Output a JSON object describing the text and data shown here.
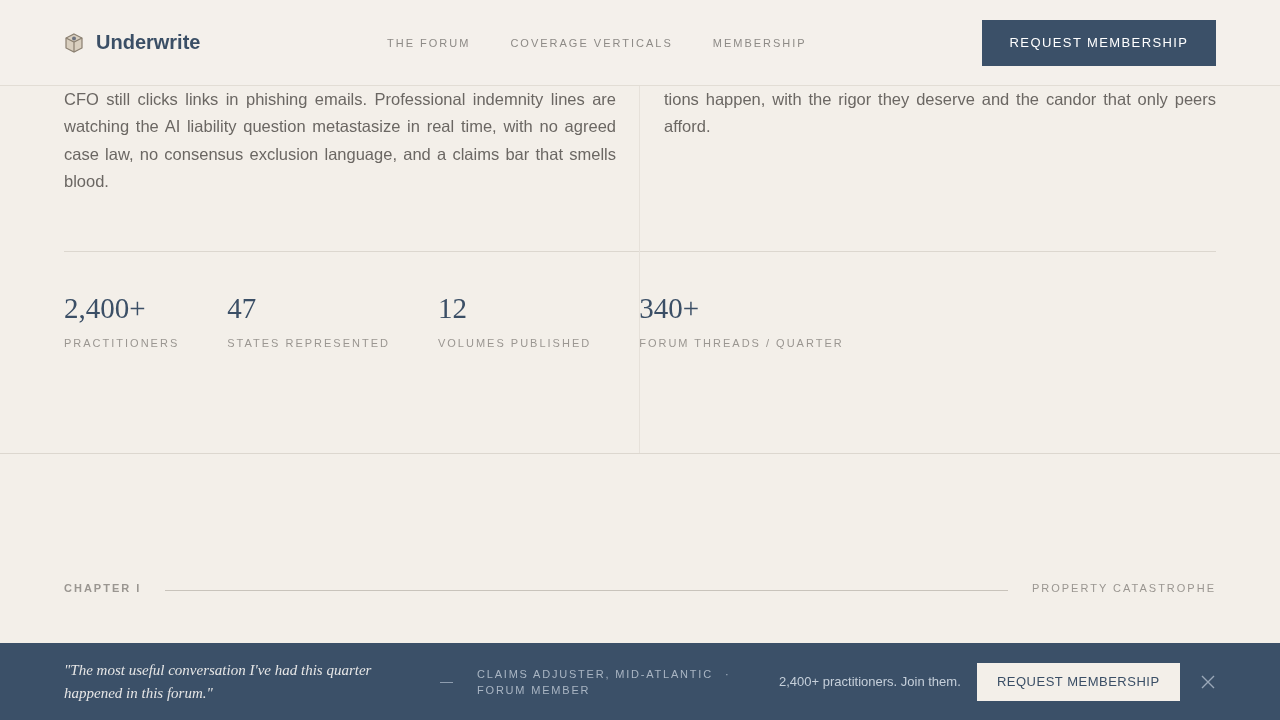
{
  "header": {
    "brand": "Underwrite",
    "nav": [
      {
        "label": "THE FORUM"
      },
      {
        "label": "COVERAGE VERTICALS"
      },
      {
        "label": "MEMBERSHIP"
      }
    ],
    "cta": "REQUEST MEMBERSHIP"
  },
  "intro": {
    "columns": [
      "CFO still clicks links in phishing emails. Professional indemnity lines are watching the AI liability question metastasize in real time, with no agreed case law, no consensus exclusion language, and a claims bar that smells blood.",
      "tions happen, with the rigor they deserve and the candor that only peers afford."
    ]
  },
  "stats": [
    {
      "value": "2,400+",
      "label": "PRACTITIONERS"
    },
    {
      "value": "47",
      "label": "STATES REPRESENTED"
    },
    {
      "value": "12",
      "label": "VOLUMES PUBLISHED"
    },
    {
      "value": "340+",
      "label": "FORUM THREADS / QUARTER"
    }
  ],
  "chapter": {
    "number": "CHAPTER I",
    "title": "PROPERTY CATASTROPHE"
  },
  "banner": {
    "quote": "\"The most useful conversation I've had this quarter happened in this forum.\"",
    "dash": "—",
    "attribution": "CLAIMS ADJUSTER, MID-ATLANTIC",
    "separator": "·",
    "role": "FORUM MEMBER",
    "pitch": "2,400+ practitioners. Join them.",
    "cta": "REQUEST MEMBERSHIP"
  }
}
